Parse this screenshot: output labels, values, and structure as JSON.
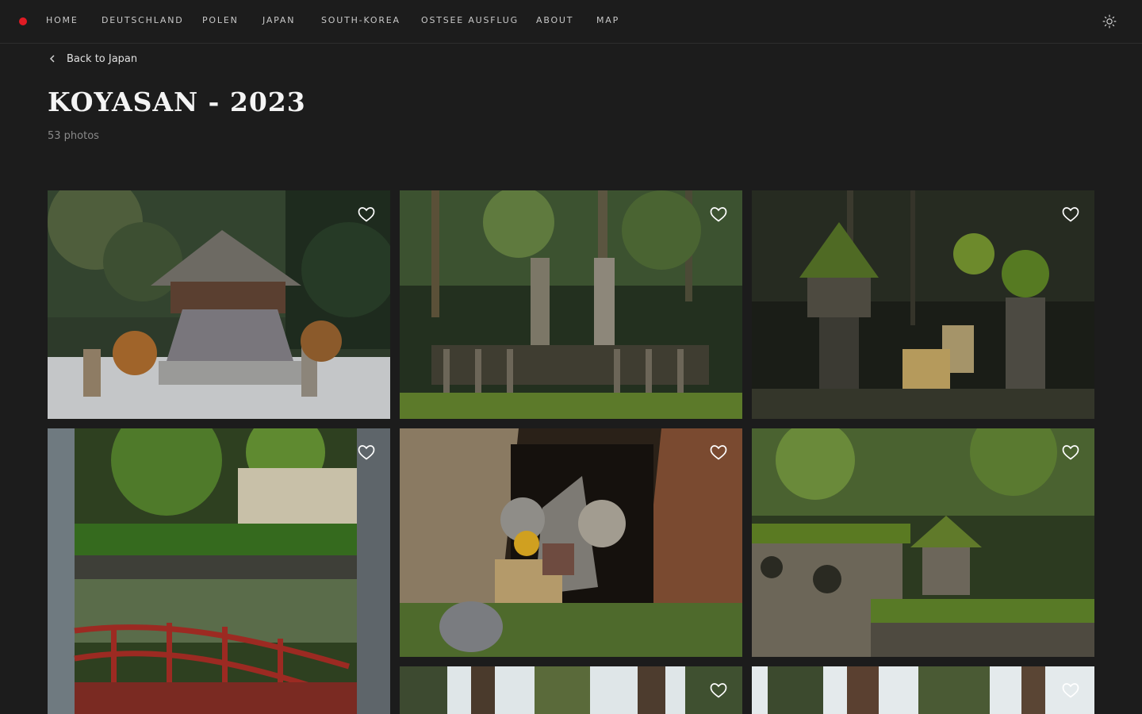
{
  "nav": {
    "items": [
      "HOME",
      "DEUTSCHLAND",
      "POLEN",
      "JAPAN",
      "SOUTH-KOREA",
      "OSTSEE AUSFLUG",
      "ABOUT",
      "MAP"
    ],
    "brand_color": "#e01b24",
    "theme_icon": "sun-icon"
  },
  "back": {
    "label": "Back to Japan",
    "icon": "chevron-left-icon"
  },
  "album": {
    "title": "KOYASAN - 2023",
    "count": "53 photos"
  },
  "gallery": {
    "favorite_icon": "heart-icon",
    "photos": [
      {
        "subject": "temple bell tower"
      },
      {
        "subject": "cemetery gravestones"
      },
      {
        "subject": "mossy stone lanterns"
      },
      {
        "subject": "red bridge over pond"
      },
      {
        "subject": "tree hollow shrine"
      },
      {
        "subject": "mossy ruins"
      },
      {
        "subject": "cedar forest"
      },
      {
        "subject": "cedar forest"
      }
    ]
  }
}
